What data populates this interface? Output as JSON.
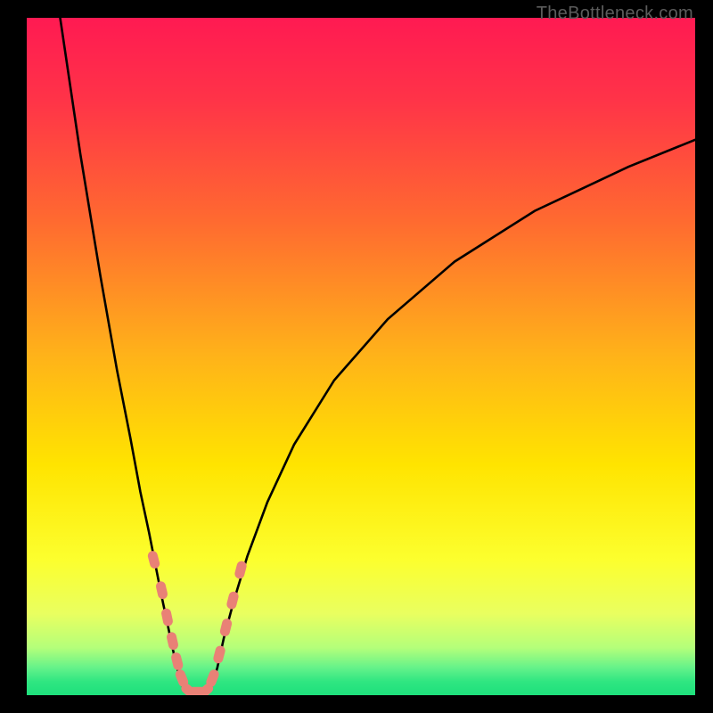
{
  "watermark": "TheBottleneck.com",
  "chart_data": {
    "type": "line",
    "title": "",
    "xlabel": "",
    "ylabel": "",
    "xlim": [
      0,
      100
    ],
    "ylim": [
      0,
      100
    ],
    "background_gradient": {
      "stops": [
        {
          "pct": 0,
          "color": "#ff1a52"
        },
        {
          "pct": 12,
          "color": "#ff3348"
        },
        {
          "pct": 30,
          "color": "#ff6a30"
        },
        {
          "pct": 50,
          "color": "#ffb319"
        },
        {
          "pct": 66,
          "color": "#ffe400"
        },
        {
          "pct": 80,
          "color": "#fcff2e"
        },
        {
          "pct": 88,
          "color": "#e9ff60"
        },
        {
          "pct": 93,
          "color": "#b4ff7a"
        },
        {
          "pct": 96,
          "color": "#63f28a"
        },
        {
          "pct": 98,
          "color": "#2fe681"
        },
        {
          "pct": 100,
          "color": "#1ee07c"
        }
      ]
    },
    "curve_left": {
      "comment": "steep descending branch from top-left edge into the valley",
      "x": [
        5.0,
        8.0,
        11.0,
        13.5,
        15.5,
        17.0,
        18.3,
        19.3,
        20.2,
        21.0,
        21.7,
        22.3,
        22.9,
        23.5
      ],
      "y": [
        100.0,
        80.0,
        62.0,
        48.0,
        38.0,
        30.0,
        24.0,
        19.0,
        14.5,
        10.8,
        7.5,
        4.8,
        2.5,
        0.8
      ]
    },
    "curve_right": {
      "comment": "ascending branch from valley toward upper-right",
      "x": [
        27.5,
        28.5,
        29.5,
        31.0,
        33.0,
        36.0,
        40.0,
        46.0,
        54.0,
        64.0,
        76.0,
        90.0,
        100.0
      ],
      "y": [
        0.8,
        4.0,
        8.5,
        14.0,
        20.5,
        28.5,
        37.0,
        46.5,
        55.5,
        64.0,
        71.5,
        78.0,
        82.0
      ]
    },
    "markers": {
      "comment": "salmon capsule markers along lower branches and valley floor",
      "points": [
        {
          "x": 19.0,
          "y": 20.0
        },
        {
          "x": 20.2,
          "y": 15.5
        },
        {
          "x": 21.0,
          "y": 11.5
        },
        {
          "x": 21.8,
          "y": 8.0
        },
        {
          "x": 22.5,
          "y": 5.0
        },
        {
          "x": 23.2,
          "y": 2.5
        },
        {
          "x": 24.3,
          "y": 0.6
        },
        {
          "x": 25.5,
          "y": 0.5
        },
        {
          "x": 26.7,
          "y": 0.6
        },
        {
          "x": 27.8,
          "y": 2.5
        },
        {
          "x": 28.8,
          "y": 6.0
        },
        {
          "x": 29.8,
          "y": 10.0
        },
        {
          "x": 30.8,
          "y": 14.0
        },
        {
          "x": 32.0,
          "y": 18.5
        }
      ],
      "color": "#e98176"
    }
  }
}
